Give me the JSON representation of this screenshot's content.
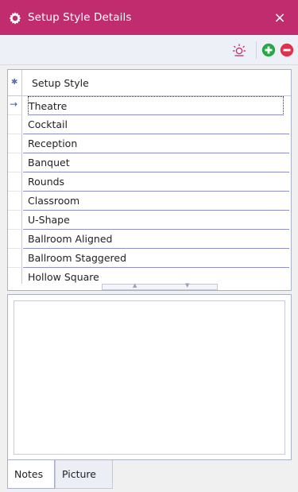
{
  "window": {
    "title": "Setup Style Details",
    "close_label": "×"
  },
  "grid": {
    "header_indicator": "✱",
    "column_header": "Setup Style",
    "rows": [
      "Theatre",
      "Cocktail",
      "Reception",
      "Banquet",
      "Rounds",
      "Classroom",
      "U-Shape",
      "Ballroom Aligned",
      "Ballroom Staggered",
      "Hollow Square"
    ],
    "current_row_arrow": "→"
  },
  "tabs": {
    "notes": "Notes",
    "picture": "Picture"
  },
  "colors": {
    "titlebar": "#c02c6e",
    "add": "#27a844",
    "remove": "#e0314a",
    "refresh": "#c02c6e"
  }
}
